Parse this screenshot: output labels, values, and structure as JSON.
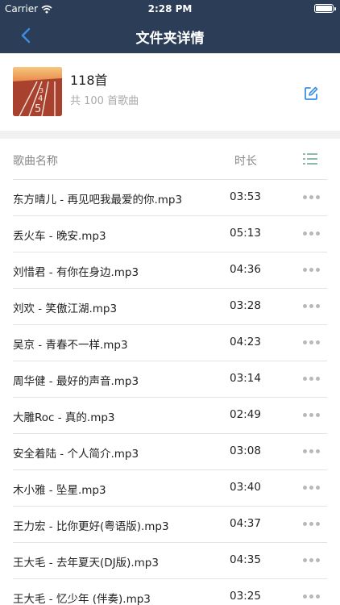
{
  "status_bar": {
    "carrier": "Carrier",
    "time": "2:28 PM"
  },
  "nav": {
    "title": "文件夹详情",
    "icons": {
      "back": "chevron-left-icon"
    }
  },
  "folder": {
    "name": "118首",
    "count": "共 100 首歌曲",
    "icons": {
      "edit": "edit-icon"
    }
  },
  "list_header": {
    "name_label": "歌曲名称",
    "duration_label": "时长",
    "icons": {
      "list": "list-icon"
    }
  },
  "songs": [
    {
      "title": "东方晴儿 - 再见吧我最爱的你.mp3",
      "duration": "03:53"
    },
    {
      "title": "丢火车 - 晚安.mp3",
      "duration": "05:13"
    },
    {
      "title": "刘惜君 - 有你在身边.mp3",
      "duration": "04:36"
    },
    {
      "title": "刘欢 - 笑傲江湖.mp3",
      "duration": "03:28"
    },
    {
      "title": "吴京 - 青春不一样.mp3",
      "duration": "04:23"
    },
    {
      "title": "周华健 - 最好的声音.mp3",
      "duration": "03:14"
    },
    {
      "title": "大雕Roc - 真的.mp3",
      "duration": "02:49"
    },
    {
      "title": "安全着陆 - 个人简介.mp3",
      "duration": "03:08"
    },
    {
      "title": "木小雅 - 坠星.mp3",
      "duration": "03:40"
    },
    {
      "title": "王力宏 - 比你更好(粤语版).mp3",
      "duration": "04:37"
    },
    {
      "title": "王大毛 - 去年夏天(DJ版).mp3",
      "duration": "04:35"
    },
    {
      "title": "王大毛 - 忆少年 (伴奏).mp3",
      "duration": "03:25"
    }
  ],
  "colors": {
    "nav_bg": "#2c3e57",
    "accent": "#3a8ee6",
    "separator_band": "#f1f1f1"
  }
}
